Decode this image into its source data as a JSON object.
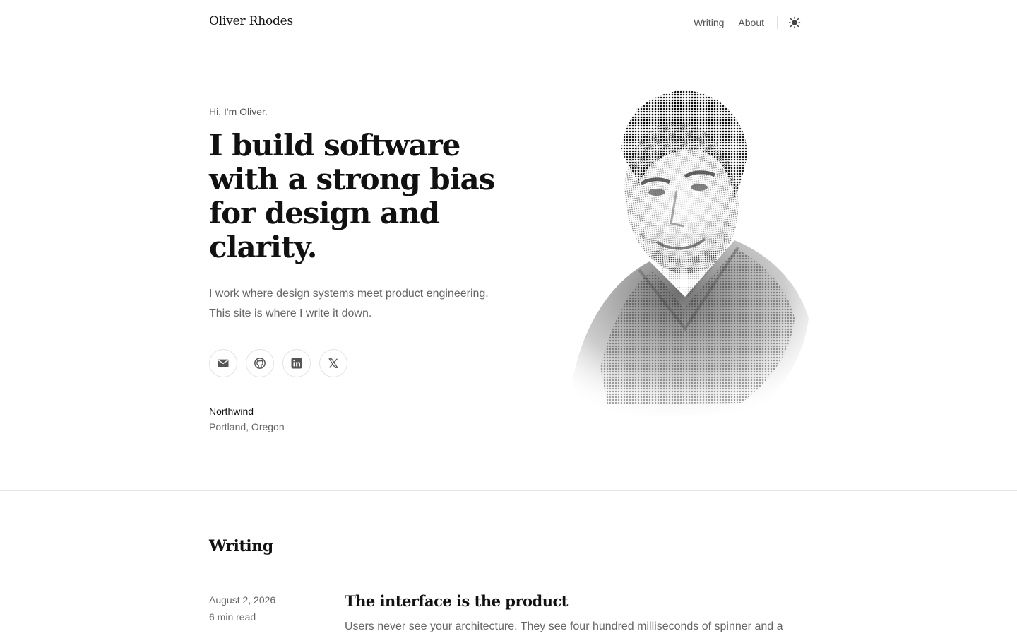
{
  "header": {
    "brand": "Oliver Rhodes",
    "nav": [
      {
        "label": "Writing"
      },
      {
        "label": "About"
      }
    ],
    "theme_icon": "sun-icon"
  },
  "hero": {
    "greeting": "Hi, I'm Oliver.",
    "headline": "I build software with a strong bias for design and clarity.",
    "intro_lines": [
      "I work where design systems meet product engineering.",
      "This site is where I write it down."
    ],
    "socials": [
      {
        "icon": "mail-icon"
      },
      {
        "icon": "github-icon"
      },
      {
        "icon": "linkedin-icon"
      },
      {
        "icon": "x-icon"
      }
    ],
    "company": "Northwind",
    "location": "Portland, Oregon"
  },
  "writing": {
    "title": "Writing",
    "posts": [
      {
        "date": "August 2, 2026",
        "read_time": "6 min read",
        "title": "The interface is the product",
        "excerpt": "Users never see your architecture. They see four hundred milliseconds of spinner and a"
      }
    ]
  }
}
